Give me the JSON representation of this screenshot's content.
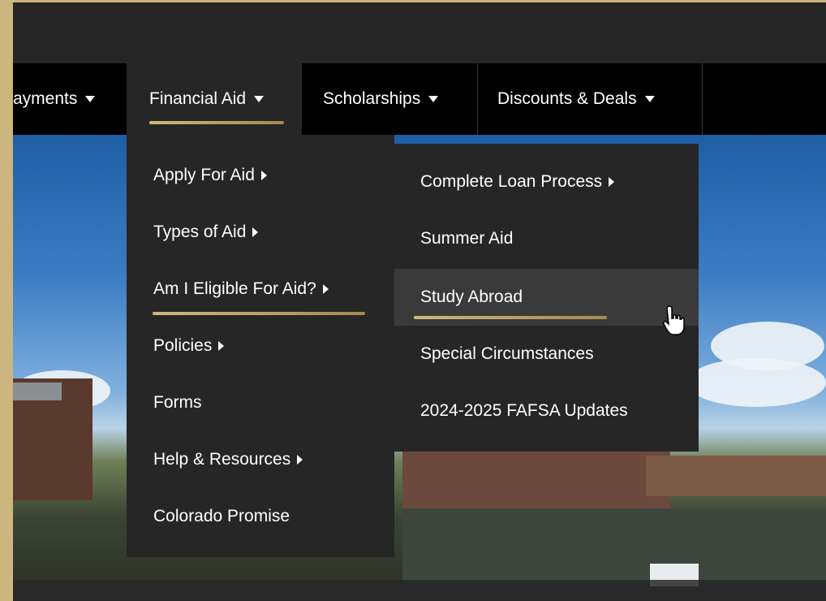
{
  "nav": {
    "items": [
      {
        "label": "ayments",
        "active": false
      },
      {
        "label": "Financial Aid",
        "active": true
      },
      {
        "label": "Scholarships",
        "active": false
      },
      {
        "label": "Discounts & Deals",
        "active": false
      }
    ]
  },
  "financial_aid_menu": {
    "items": [
      {
        "label": "Apply For Aid",
        "has_submenu": true
      },
      {
        "label": "Types of Aid",
        "has_submenu": true
      },
      {
        "label": "Am I Eligible For Aid?",
        "has_submenu": true
      },
      {
        "label": "Policies",
        "has_submenu": true
      },
      {
        "label": "Forms",
        "has_submenu": false
      },
      {
        "label": "Help & Resources",
        "has_submenu": true
      },
      {
        "label": "Colorado Promise",
        "has_submenu": false
      }
    ]
  },
  "eligible_submenu": {
    "items": [
      {
        "label": "Complete Loan Process",
        "has_submenu": true
      },
      {
        "label": "Summer Aid",
        "has_submenu": false
      },
      {
        "label": "Study Abroad",
        "has_submenu": false,
        "hovered": true
      },
      {
        "label": "Special Circumstances",
        "has_submenu": false
      },
      {
        "label": "2024-2025 FAFSA Updates",
        "has_submenu": false
      }
    ]
  },
  "colors": {
    "gold_accent": "#cfb87c",
    "nav_background": "#000000",
    "menu_background": "#262626",
    "hover_background": "#3a3a3a"
  }
}
